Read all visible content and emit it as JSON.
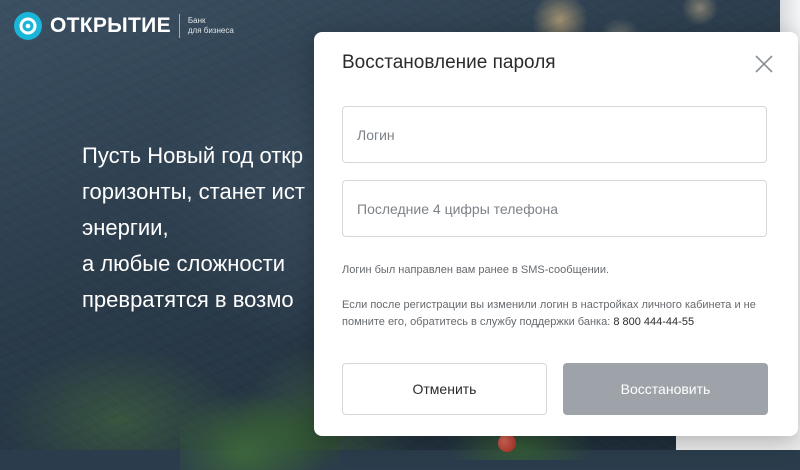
{
  "header": {
    "brand": "ОТКРЫТИЕ",
    "sub_line1": "Банк",
    "sub_line2": "для бизнеса",
    "brand_color": "#19b6d9",
    "logo_icon": "otkrytie-logo-icon"
  },
  "promo": {
    "lines": [
      "Пусть Новый год откр",
      "горизонты, станет ист",
      "энергии,",
      "а любые сложности",
      "превратятся в возмо"
    ]
  },
  "modal": {
    "title": "Восстановление пароля",
    "close_icon": "close-icon",
    "login_placeholder": "Логин",
    "login_value": "",
    "phone_placeholder": "Последние 4 цифры телефона",
    "phone_value": "",
    "hint_sms": "Логин был направлен вам ранее в SMS-сообщении.",
    "hint_support": "Если после регистрации вы изменили логин в настройках личного кабинета и не помните его, обратитесь в службу поддержки банка:",
    "support_phone": "8 800 444-44-55",
    "cancel_label": "Отменить",
    "restore_label": "Восстановить",
    "restore_color": "#9ea3a9"
  }
}
